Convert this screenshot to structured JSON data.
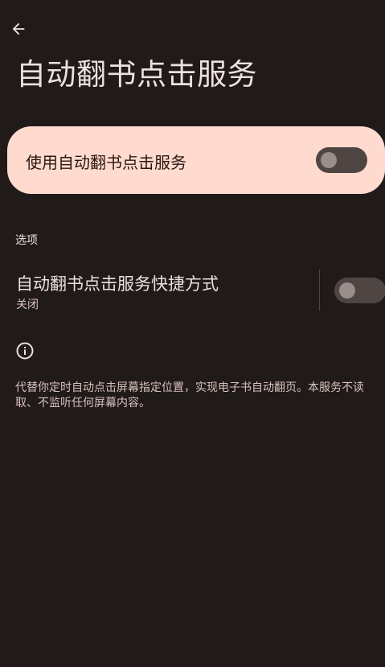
{
  "header": {
    "back_icon": "arrow-back-icon",
    "title": "自动翻书点击服务"
  },
  "main_switch": {
    "label": "使用自动翻书点击服务",
    "enabled": false
  },
  "options_section": {
    "header": "选项",
    "shortcut": {
      "title": "自动翻书点击服务快捷方式",
      "summary": "关闭",
      "enabled": false
    }
  },
  "footer": {
    "icon": "info-icon",
    "description": "代替你定时自动点击屏幕指定位置，实现电子书自动翻页。本服务不读取、不监听任何屏幕内容。"
  },
  "colors": {
    "background": "#201a19",
    "card": "#ffdbcf",
    "toggle_track_off": "#4f4543",
    "toggle_thumb_off": "#998e8c",
    "text_primary": "#ede0dd",
    "text_secondary": "#d8c2be"
  }
}
